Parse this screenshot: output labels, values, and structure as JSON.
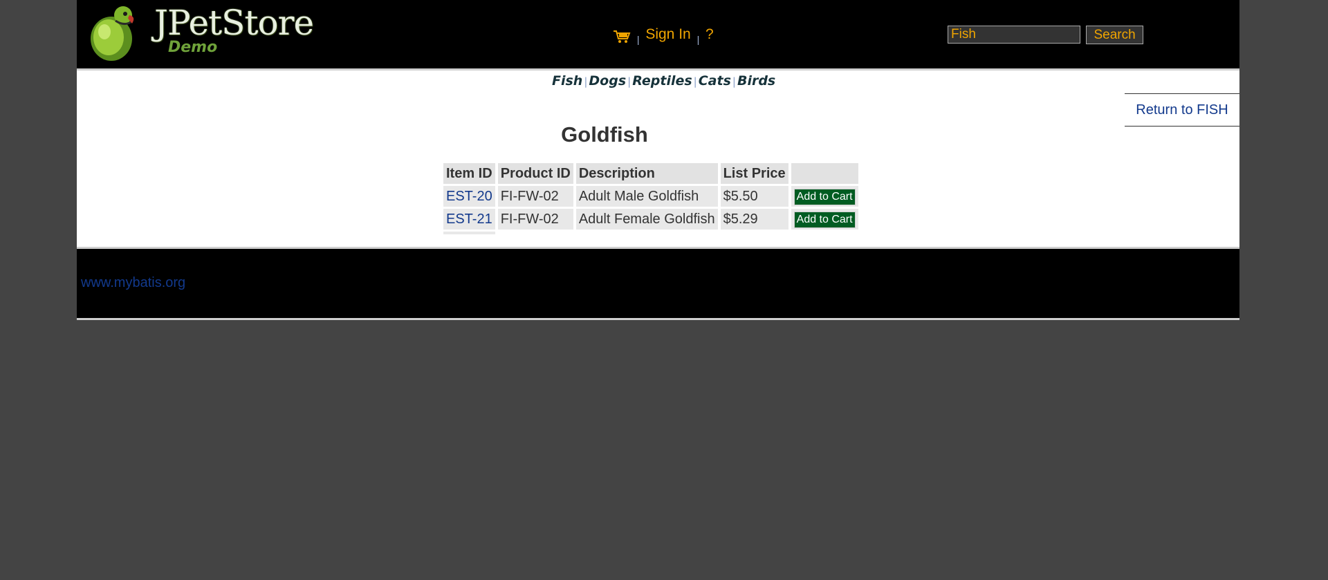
{
  "header": {
    "logo_title": "JPetStore",
    "logo_subtitle": "Demo",
    "menu": {
      "cart_icon": "shopping-cart-icon",
      "sign_in_label": "Sign In",
      "help_label": "?",
      "separator": "|"
    },
    "search": {
      "value": "Fish",
      "button_label": "Search"
    }
  },
  "quicklinks": {
    "items": [
      "Fish",
      "Dogs",
      "Reptiles",
      "Cats",
      "Birds"
    ],
    "separator": "|"
  },
  "back_link_label": "Return to FISH",
  "page_title": "Goldfish",
  "table": {
    "headers": [
      "Item ID",
      "Product ID",
      "Description",
      "List Price",
      ""
    ],
    "rows": [
      {
        "item_id": "EST-20",
        "product_id": "FI-FW-02",
        "description": "Adult Male Goldfish",
        "price": "$5.50",
        "action": "Add to Cart"
      },
      {
        "item_id": "EST-21",
        "product_id": "FI-FW-02",
        "description": "Adult Female Goldfish",
        "price": "$5.29",
        "action": "Add to Cart"
      }
    ]
  },
  "footer": {
    "link_label": "www.mybatis.org"
  },
  "colors": {
    "page_background": "#444444",
    "header_background": "#000000",
    "accent_orange": "#f0a500",
    "link_blue": "#12398c",
    "cart_button_green": "#015c22"
  }
}
